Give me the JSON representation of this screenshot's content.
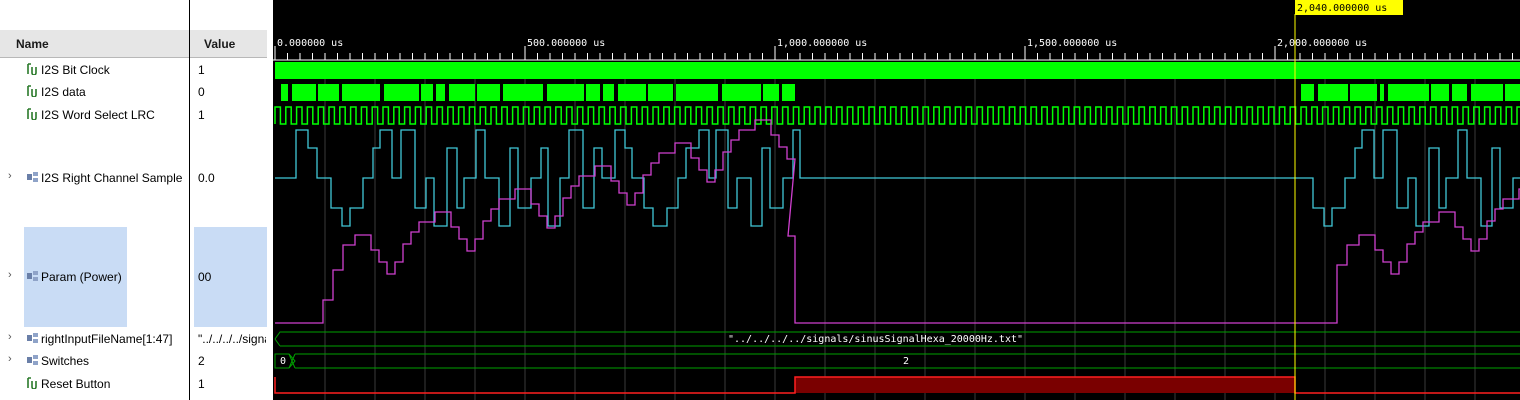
{
  "header": {
    "name": "Name",
    "value": "Value"
  },
  "signals": [
    {
      "name": "I2S Bit Clock",
      "value": "1",
      "icon": "logic-signal-icon",
      "expandable": false
    },
    {
      "name": "I2S data",
      "value": "0",
      "icon": "logic-signal-icon",
      "expandable": false
    },
    {
      "name": "I2S Word Select LRC",
      "value": "1",
      "icon": "logic-signal-icon",
      "expandable": false
    },
    {
      "name": "I2S Right Channel Sample",
      "value": "0.0",
      "icon": "bus-signal-icon",
      "expandable": true
    },
    {
      "name": "Param (Power)",
      "value": "00",
      "icon": "bus-signal-icon",
      "expandable": true
    },
    {
      "name": "rightInputFileName[1:47]",
      "value": "\"../../../../signa",
      "icon": "bus-signal-icon",
      "expandable": true
    },
    {
      "name": "Switches",
      "value": "2",
      "icon": "bus-signal-icon",
      "expandable": true
    },
    {
      "name": "Reset Button",
      "value": "1",
      "icon": "logic-signal-icon",
      "expandable": false
    }
  ],
  "timeline": {
    "ticks": [
      "0.000000 us",
      "500.000000 us",
      "1,000.000000 us",
      "1,500.000000 us",
      "2,000.000000 us"
    ],
    "cursor_label": "2,040.000000 us",
    "cursor_time_us": 2040
  },
  "bus_values": {
    "file_name": "\"../../../../signals/sinusSignalHexa_20000Hz.txt\"",
    "switches_initial": "0",
    "switches_value": "2"
  },
  "colors": {
    "background": "#000000",
    "digital": "#00ff00",
    "analog_sample": "#40c8d8",
    "analog_power": "#d040d0",
    "reset_fill": "#7a0000",
    "reset_line": "#ff2020",
    "cursor": "#ffff00",
    "bus_outline": "#00a000"
  }
}
